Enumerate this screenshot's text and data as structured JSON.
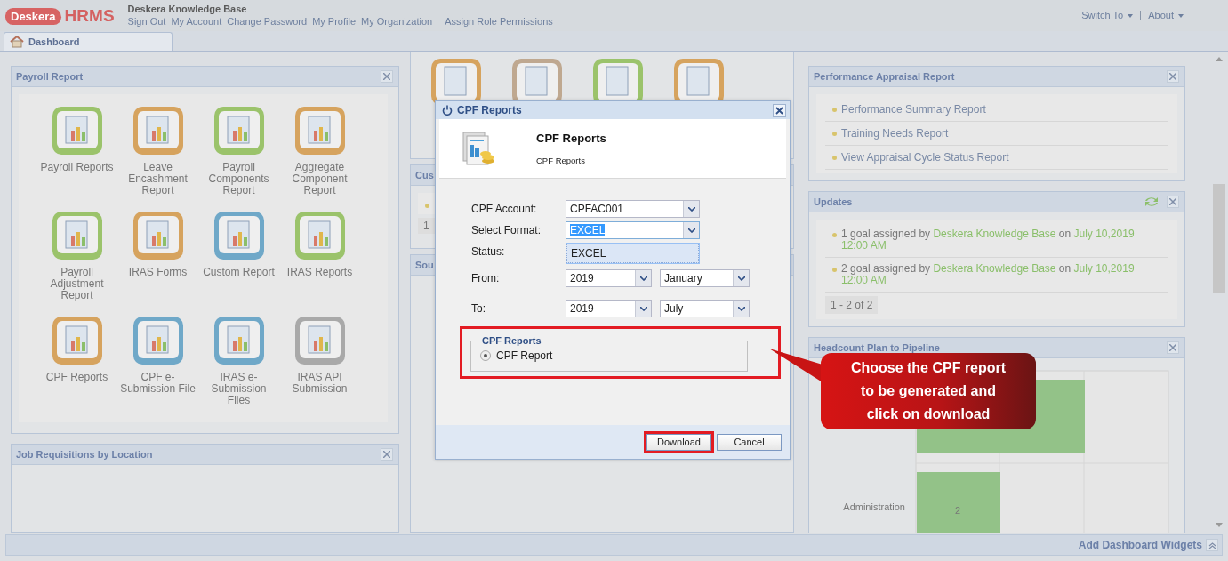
{
  "header": {
    "logo_brand": "Deskera",
    "logo_product": "HRMS",
    "org": "Deskera Knowledge Base",
    "links": [
      "Sign Out",
      "My Account",
      "Change Password",
      "My Profile",
      "My Organization",
      "Assign Role Permissions"
    ],
    "menus": [
      "Switch To",
      "About"
    ]
  },
  "tabs": [
    {
      "label": "Dashboard",
      "selected": true
    }
  ],
  "payroll_report": {
    "title": "Payroll Report",
    "items": [
      {
        "label": "Payroll Reports",
        "color": "#9bc36b"
      },
      {
        "label": "Leave Encashment Report",
        "color": "#d6a35e"
      },
      {
        "label": "Payroll Components Report",
        "color": "#9bc36b"
      },
      {
        "label": "Aggregate Component Report",
        "color": "#d6a35e"
      },
      {
        "label": "Payroll Adjustment Report",
        "color": "#9bc36b"
      },
      {
        "label": "IRAS Forms",
        "color": "#d6a35e"
      },
      {
        "label": "Custom Report",
        "color": "#6fa8c8"
      },
      {
        "label": "IRAS Reports",
        "color": "#9bc36b"
      },
      {
        "label": "CPF Reports",
        "color": "#d6a35e"
      },
      {
        "label": "CPF e-Submission File",
        "color": "#6fa8c8"
      },
      {
        "label": "IRAS e-Submission Files",
        "color": "#6fa8c8"
      },
      {
        "label": "IRAS API Submission",
        "color": "#a9a9a9"
      }
    ]
  },
  "job_requisitions": {
    "title": "Job Requisitions by Location"
  },
  "middle_icons": [
    {
      "color": "#d6a35e"
    },
    {
      "color": "#bfa890"
    },
    {
      "color": "#9bc36b"
    },
    {
      "color": "#d6a35e"
    }
  ],
  "middle_panels": [
    {
      "title": "Cus",
      "pager": "1"
    },
    {
      "title": "Sou"
    }
  ],
  "dialog": {
    "title": "CPF Reports",
    "heading": "CPF Reports",
    "subheading": "CPF Reports",
    "account": {
      "label": "CPF Account:",
      "value": "CPFAC001"
    },
    "format": {
      "label": "Select Format:",
      "value": "EXCEL",
      "open": true,
      "options": [
        {
          "label": "EXCEL",
          "selected": true
        }
      ]
    },
    "status": {
      "label": "Status:"
    },
    "from": {
      "label": "From:",
      "year": "2019",
      "month": "January"
    },
    "to": {
      "label": "To:",
      "year": "2019",
      "month": "July"
    },
    "report_group": {
      "legend": "CPF Reports",
      "highlighted": true,
      "options": [
        {
          "label": "CPF Report",
          "selected": true
        }
      ]
    },
    "buttons": [
      {
        "label": "Download",
        "highlighted": true
      },
      {
        "label": "Cancel",
        "highlighted": false
      }
    ]
  },
  "callout": {
    "text": "Choose the CPF report to be generated and click on download"
  },
  "appraisal": {
    "title": "Performance Appraisal Report",
    "items": [
      "Performance Summary Report",
      "Training Needs Report",
      "View Appraisal Cycle Status Report"
    ]
  },
  "updates": {
    "title": "Updates",
    "items": [
      {
        "prefix": "1 goal assigned by",
        "author": "Deskera Knowledge Base",
        "on": "on",
        "date": "July 10,2019 12:00 AM"
      },
      {
        "prefix": "2 goal assigned by",
        "author": "Deskera Knowledge Base",
        "on": "on",
        "date": "July 10,2019 12:00 AM"
      }
    ],
    "pager": "1 - 2 of 2"
  },
  "headcount": {
    "title": "Headcount Plan to Pipeline",
    "row_label": "Administration",
    "bar_label": "2"
  },
  "footer": {
    "label": "Add Dashboard Widgets"
  }
}
